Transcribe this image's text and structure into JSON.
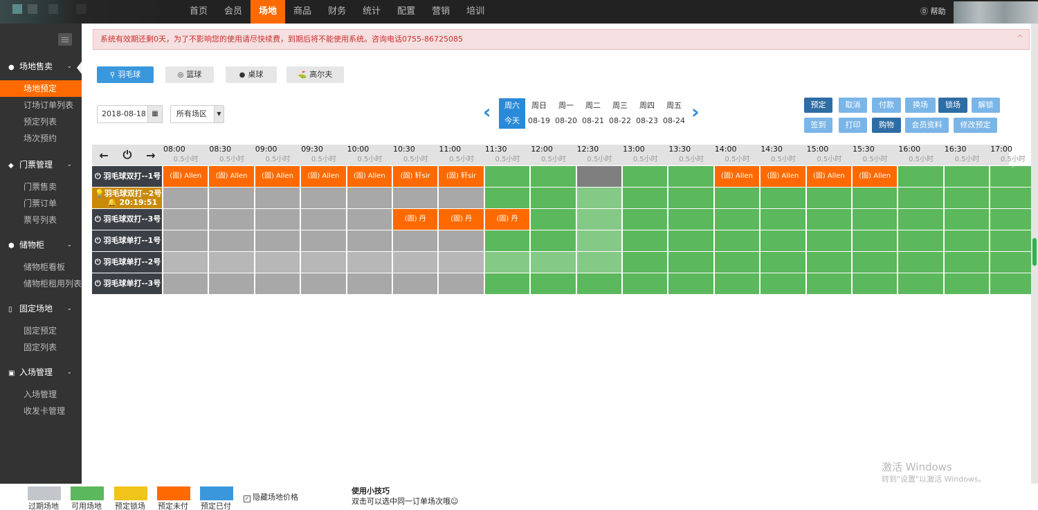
{
  "topnav": [
    "首页",
    "会员",
    "场地",
    "商品",
    "财务",
    "统计",
    "配置",
    "营销",
    "培训"
  ],
  "topnav_active_index": 2,
  "help_label": "帮助",
  "sidebar": {
    "groups": [
      {
        "label": "场地售卖",
        "icon": "globe-icon",
        "items": [
          "场地预定",
          "订场订单列表",
          "预定列表",
          "场次预约"
        ]
      },
      {
        "label": "门票管理",
        "icon": "ticket-icon",
        "items": [
          "门票售卖",
          "门票订单",
          "票号列表"
        ]
      },
      {
        "label": "储物柜",
        "icon": "cube-icon",
        "items": [
          "储物柜看板",
          "储物柜租用列表"
        ]
      },
      {
        "label": "固定场地",
        "icon": "bookmark-icon",
        "items": [
          "固定预定",
          "固定列表"
        ]
      },
      {
        "label": "入场管理",
        "icon": "id-card-icon",
        "items": [
          "入场管理",
          "收发卡管理"
        ]
      }
    ],
    "active_item": "场地预定"
  },
  "notice": "系统有效期还剩0天，为了不影响您的使用请尽快续费，到期后将不能使用系统。咨询电话0755-86725085",
  "sports": [
    {
      "label": "羽毛球",
      "icon": "shuttlecock-icon"
    },
    {
      "label": "篮球",
      "icon": "basketball-icon"
    },
    {
      "label": "桌球",
      "icon": "billiard-icon"
    },
    {
      "label": "高尔夫",
      "icon": "golf-icon"
    }
  ],
  "date_value": "2018-08-18",
  "area_select": "所有场区",
  "days": [
    {
      "name": "周六",
      "date": "今天"
    },
    {
      "name": "周日",
      "date": "08-19"
    },
    {
      "name": "周一",
      "date": "08-20"
    },
    {
      "name": "周二",
      "date": "08-21"
    },
    {
      "name": "周三",
      "date": "08-22"
    },
    {
      "name": "周四",
      "date": "08-23"
    },
    {
      "name": "周五",
      "date": "08-24"
    }
  ],
  "ops_row1": [
    "预定",
    "取消",
    "付款",
    "换场",
    "锁场",
    "解锁"
  ],
  "ops_row2": [
    "签到",
    "打印",
    "购物",
    "会员资料",
    "修改预定"
  ],
  "times": [
    "08:00",
    "08:30",
    "09:00",
    "09:30",
    "10:00",
    "10:30",
    "11:00",
    "11:30",
    "12:00",
    "12:30",
    "13:00",
    "13:30",
    "14:00",
    "14:30",
    "15:00",
    "15:30",
    "16:00",
    "16:30",
    "17:00"
  ],
  "duration_label": "0.5小时",
  "courts": [
    {
      "name": "羽毛球双打--1号",
      "slots": [
        "o:(固) Allen",
        "o:(固) Allen",
        "o:(固) Allen",
        "o:(固) Allen",
        "o:(固) Allen",
        "o:(固) 轩sir",
        "o:(固) 轩sir",
        "g",
        "g",
        "d",
        "g",
        "g",
        "o:(固) Allen",
        "o:(固) Allen",
        "o:(固) Allen",
        "o:(固) Allen",
        "g",
        "g",
        "g"
      ]
    },
    {
      "name": "羽毛球双打--2号",
      "lock_time": "20:19:51",
      "slots": [
        "x",
        "x",
        "x",
        "x",
        "x",
        "x",
        "x",
        "g",
        "g",
        "l",
        "g",
        "g",
        "g",
        "g",
        "g",
        "g",
        "g",
        "g",
        "g"
      ]
    },
    {
      "name": "羽毛球双打--3号",
      "slots": [
        "x",
        "x",
        "x",
        "x",
        "x",
        "o:(固) 丹",
        "o:(固) 丹",
        "o:(固) 丹",
        "g",
        "l",
        "g",
        "g",
        "g",
        "g",
        "g",
        "g",
        "g",
        "g",
        "g"
      ]
    },
    {
      "name": "羽毛球单打--1号",
      "slots": [
        "x",
        "x",
        "x",
        "x",
        "x",
        "x",
        "x",
        "g",
        "g",
        "l",
        "g",
        "g",
        "g",
        "g",
        "g",
        "g",
        "g",
        "g",
        "g"
      ]
    },
    {
      "name": "羽毛球单打--2号",
      "slots": [
        "y",
        "y",
        "y",
        "y",
        "y",
        "y",
        "y",
        "l",
        "l",
        "l",
        "g",
        "g",
        "g",
        "g",
        "g",
        "g",
        "g",
        "g",
        "g"
      ]
    },
    {
      "name": "羽毛球单打--3号",
      "slots": [
        "x",
        "x",
        "x",
        "x",
        "x",
        "x",
        "x",
        "g",
        "g",
        "g",
        "g",
        "g",
        "g",
        "g",
        "g",
        "g",
        "g",
        "g",
        "g"
      ]
    }
  ],
  "legend": [
    {
      "label": "过期场地",
      "color": "#c3c7cc"
    },
    {
      "label": "可用场地",
      "color": "#5cb85c"
    },
    {
      "label": "预定锁场",
      "color": "#f0c419"
    },
    {
      "label": "预定未付",
      "color": "#ff6a00"
    },
    {
      "label": "预定已付",
      "color": "#3a97dc"
    }
  ],
  "hide_price_label": "隐藏场地价格",
  "tips_title": "使用小技巧",
  "tips_text": "双击可以选中同一订单场次哦☺",
  "watermark_title": "激活 Windows",
  "watermark_sub": "转到\"设置\"以激活 Windows。"
}
